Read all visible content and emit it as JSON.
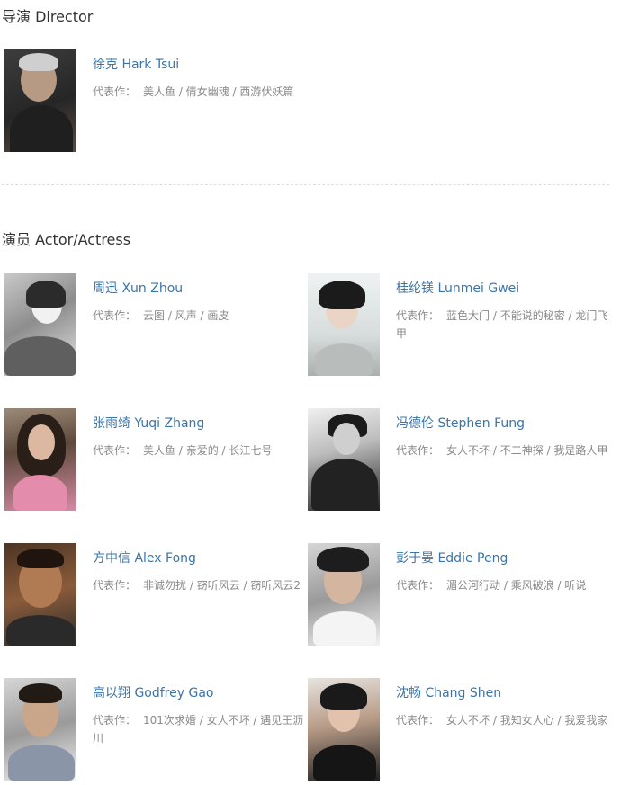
{
  "director_section": {
    "title": "导演 Director"
  },
  "cast_section": {
    "title": "演员 Actor/Actress"
  },
  "works_label": "代表作：",
  "director": {
    "name": "徐克 Hark Tsui",
    "works": "美人鱼 / 倩女幽魂 / 西游伏妖篇"
  },
  "actors": [
    {
      "name": "周迅 Xun Zhou",
      "works": "云图 / 风声 / 画皮"
    },
    {
      "name": "桂纶镁 Lunmei Gwei",
      "works": "蓝色大门 / 不能说的秘密 / 龙门飞甲"
    },
    {
      "name": "张雨绮 Yuqi Zhang",
      "works": "美人鱼 / 亲爱的 / 长江七号"
    },
    {
      "name": "冯德伦 Stephen Fung",
      "works": "女人不坏 / 不二神探 / 我是路人甲"
    },
    {
      "name": "方中信 Alex Fong",
      "works": "非诚勿扰 / 窃听风云 / 窃听风云2"
    },
    {
      "name": "彭于晏 Eddie Peng",
      "works": "湄公河行动 / 乘风破浪 / 听说"
    },
    {
      "name": "高以翔 Godfrey Gao",
      "works": "101次求婚 / 女人不坏 / 遇见王沥川"
    },
    {
      "name": "沈畅 Chang Shen",
      "works": "女人不坏 / 我知女人心 / 我爱我家"
    }
  ]
}
